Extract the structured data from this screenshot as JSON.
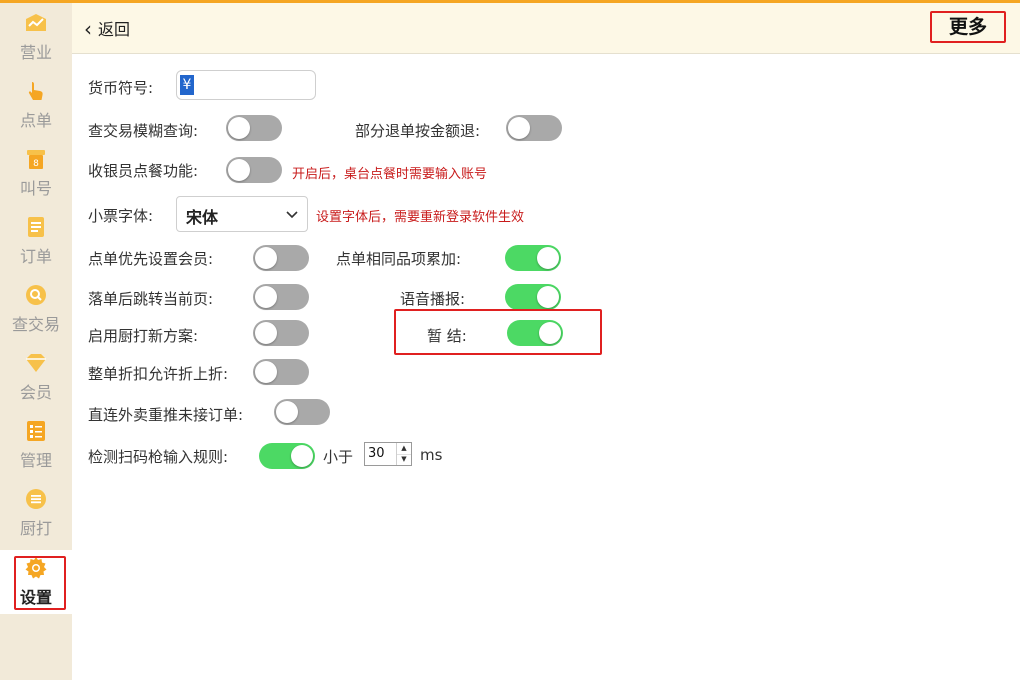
{
  "sidebar": {
    "items": [
      {
        "label": "营业",
        "icon": "business-icon"
      },
      {
        "label": "点单",
        "icon": "order-tap-icon"
      },
      {
        "label": "叫号",
        "icon": "call-number-icon"
      },
      {
        "label": "订单",
        "icon": "orders-icon"
      },
      {
        "label": "查交易",
        "icon": "search-transaction-icon"
      },
      {
        "label": "会员",
        "icon": "member-diamond-icon"
      },
      {
        "label": "管理",
        "icon": "management-icon"
      },
      {
        "label": "厨打",
        "icon": "kitchen-print-icon"
      },
      {
        "label": "设置",
        "icon": "settings-gear-icon"
      }
    ],
    "active": "设置"
  },
  "header": {
    "back_label": "返回",
    "more_label": "更多"
  },
  "settings": {
    "currency": {
      "label": "货币符号:",
      "value": "¥"
    },
    "fuzzy_search": {
      "label": "查交易模糊查询:",
      "on": false
    },
    "partial_refund": {
      "label": "部分退单按金额退:",
      "on": false
    },
    "cashier_order": {
      "label": "收银员点餐功能:",
      "on": false,
      "hint": "开启后，桌台点餐时需要输入账号"
    },
    "receipt_font": {
      "label": "小票字体:",
      "value": "宋体",
      "hint": "设置字体后，需要重新登录软件生效"
    },
    "member_priority": {
      "label": "点单优先设置会员:",
      "on": false
    },
    "same_item_merge": {
      "label": "点单相同品项累加:",
      "on": true
    },
    "jump_after_order": {
      "label": "落单后跳转当前页:",
      "on": false
    },
    "voice_broadcast": {
      "label": "语音播报:",
      "on": true
    },
    "new_kitchen_print": {
      "label": "启用厨打新方案:",
      "on": false
    },
    "temp_settle": {
      "label": "暂 结:",
      "on": true
    },
    "discount_on_discount": {
      "label": "整单折扣允许折上折:",
      "on": false
    },
    "delivery_repush": {
      "label": "直连外卖重推未接订单:",
      "on": false
    },
    "scanner_rule": {
      "label": "检测扫码枪输入规则:",
      "on": true,
      "less_than": "小于",
      "value": "30",
      "unit": "ms"
    }
  },
  "colors": {
    "accent": "#f5a623",
    "toggle_on": "#4cd964",
    "toggle_off": "#a9a9a9",
    "highlight": "#e02020",
    "hint": "#c81b1b"
  }
}
